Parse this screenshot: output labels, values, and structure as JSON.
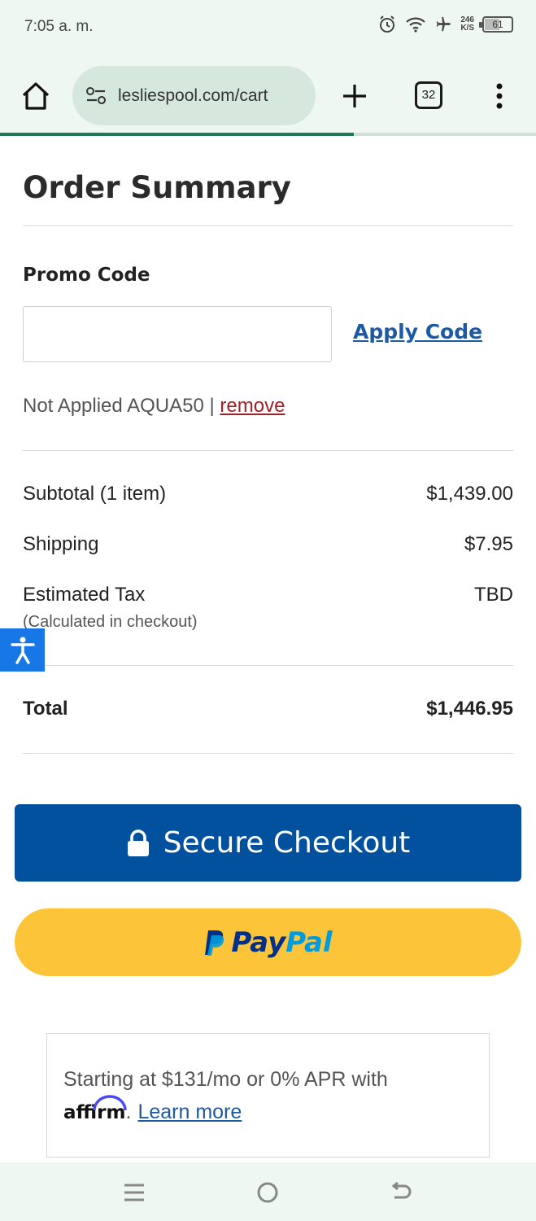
{
  "status_bar": {
    "time": "7:05 a. m.",
    "speed_value": "246",
    "speed_unit": "K/S",
    "battery": "61",
    "icons": [
      "alarm-icon",
      "wifi-icon",
      "airplane-icon",
      "battery-icon"
    ]
  },
  "browser": {
    "url": "lesliespool.com/cart",
    "tab_count": "32",
    "load_progress": 0.66
  },
  "order_summary": {
    "title": "Order Summary",
    "promo_label": "Promo Code",
    "promo_value": "",
    "apply_label": "Apply Code",
    "promo_status": "Not Applied AQUA50 |",
    "remove_label": "remove",
    "subtotal_label": "Subtotal (1 item)",
    "subtotal_value": "$1,439.00",
    "shipping_label": "Shipping",
    "shipping_value": "$7.95",
    "tax_label": "Estimated Tax",
    "tax_note": "(Calculated in checkout)",
    "tax_value": "TBD",
    "total_label": "Total",
    "total_value": "$1,446.95"
  },
  "buttons": {
    "checkout_label": "Secure Checkout",
    "paypal_part1": "Pay",
    "paypal_part2": "Pal"
  },
  "affirm": {
    "text": "Starting at $131/mo or 0% APR with",
    "logo": "affirm",
    "link": "Learn more"
  },
  "colors": {
    "checkout_blue": "#01519f",
    "paypal_yellow": "#fcc439",
    "link_blue": "#1c5aa6",
    "remove_red": "#a31f26",
    "browser_green": "#1d7a54"
  }
}
